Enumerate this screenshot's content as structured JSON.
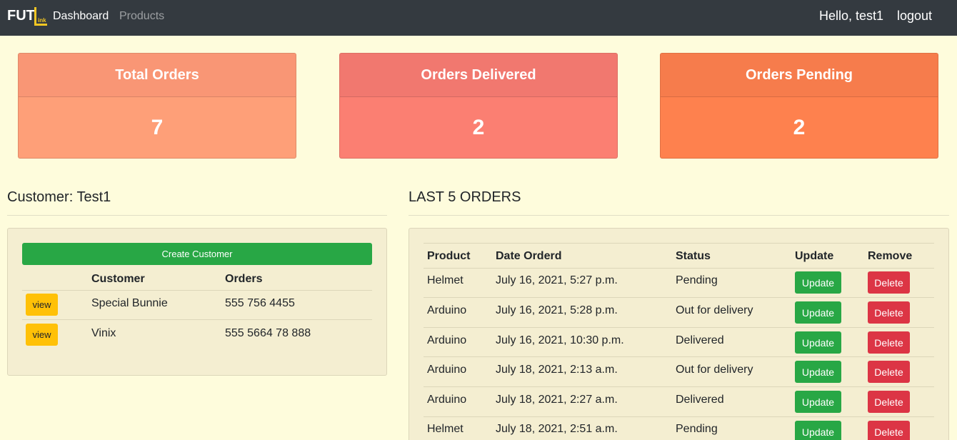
{
  "nav": {
    "logo_text": "FUT",
    "logo_sub": "ink",
    "dashboard": "Dashboard",
    "products": "Products",
    "greeting": "Hello, test1",
    "logout": "logout"
  },
  "stats": [
    {
      "title": "Total Orders",
      "value": "7"
    },
    {
      "title": "Orders Delivered",
      "value": "2"
    },
    {
      "title": "Orders Pending",
      "value": "2"
    }
  ],
  "customer_section": {
    "title": "Customer: Test1",
    "create_label": "Create Customer",
    "headers": {
      "customer": "Customer",
      "orders": "Orders"
    },
    "rows": [
      {
        "view": "view",
        "customer": "Special Bunnie",
        "orders": "555 756 4455"
      },
      {
        "view": "view",
        "customer": "Vinix",
        "orders": "555 5664 78 888"
      }
    ]
  },
  "orders_section": {
    "title": "LAST 5 ORDERS",
    "headers": {
      "product": "Product",
      "date": "Date Orderd",
      "status": "Status",
      "update": "Update",
      "remove": "Remove"
    },
    "rows": [
      {
        "product": "Helmet",
        "date": "July 16, 2021, 5:27 p.m.",
        "status": "Pending",
        "update": "Update",
        "delete": "Delete"
      },
      {
        "product": "Arduino",
        "date": "July 16, 2021, 5:28 p.m.",
        "status": "Out for delivery",
        "update": "Update",
        "delete": "Delete"
      },
      {
        "product": "Arduino",
        "date": "July 16, 2021, 10:30 p.m.",
        "status": "Delivered",
        "update": "Update",
        "delete": "Delete"
      },
      {
        "product": "Arduino",
        "date": "July 18, 2021, 2:13 a.m.",
        "status": "Out for delivery",
        "update": "Update",
        "delete": "Delete"
      },
      {
        "product": "Arduino",
        "date": "July 18, 2021, 2:27 a.m.",
        "status": "Delivered",
        "update": "Update",
        "delete": "Delete"
      },
      {
        "product": "Helmet",
        "date": "July 18, 2021, 2:51 a.m.",
        "status": "Pending",
        "update": "Update",
        "delete": "Delete"
      }
    ]
  },
  "colors": {
    "navbar": "#343a40",
    "page_bg": "#fefcdc",
    "panel_bg": "#f4eed1",
    "success": "#28a745",
    "danger": "#dc3545",
    "warning": "#ffc107"
  }
}
